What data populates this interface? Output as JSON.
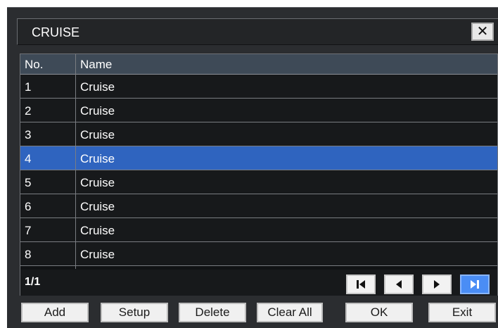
{
  "dialog": {
    "title": "CRUISE",
    "close_label": "✕"
  },
  "table": {
    "columns": [
      "No.",
      "Name"
    ],
    "rows": [
      {
        "no": "1",
        "name": "Cruise"
      },
      {
        "no": "2",
        "name": "Cruise"
      },
      {
        "no": "3",
        "name": "Cruise"
      },
      {
        "no": "4",
        "name": "Cruise"
      },
      {
        "no": "5",
        "name": "Cruise"
      },
      {
        "no": "6",
        "name": "Cruise"
      },
      {
        "no": "7",
        "name": "Cruise"
      },
      {
        "no": "8",
        "name": "Cruise"
      }
    ],
    "selected_row": "4",
    "page_indicator": "1/1"
  },
  "pagination": {
    "first_icon": "first-page-icon",
    "prev_icon": "previous-page-icon",
    "next_icon": "next-page-icon",
    "last_icon": "last-page-icon"
  },
  "buttons": {
    "add": "Add",
    "setup": "Setup",
    "delete": "Delete",
    "clear_all": "Clear All",
    "ok": "OK",
    "exit": "Exit"
  },
  "colors": {
    "selected_row": "#2f64bf",
    "header_bg": "#3e4a57",
    "active_nav": "#4a8df5"
  }
}
